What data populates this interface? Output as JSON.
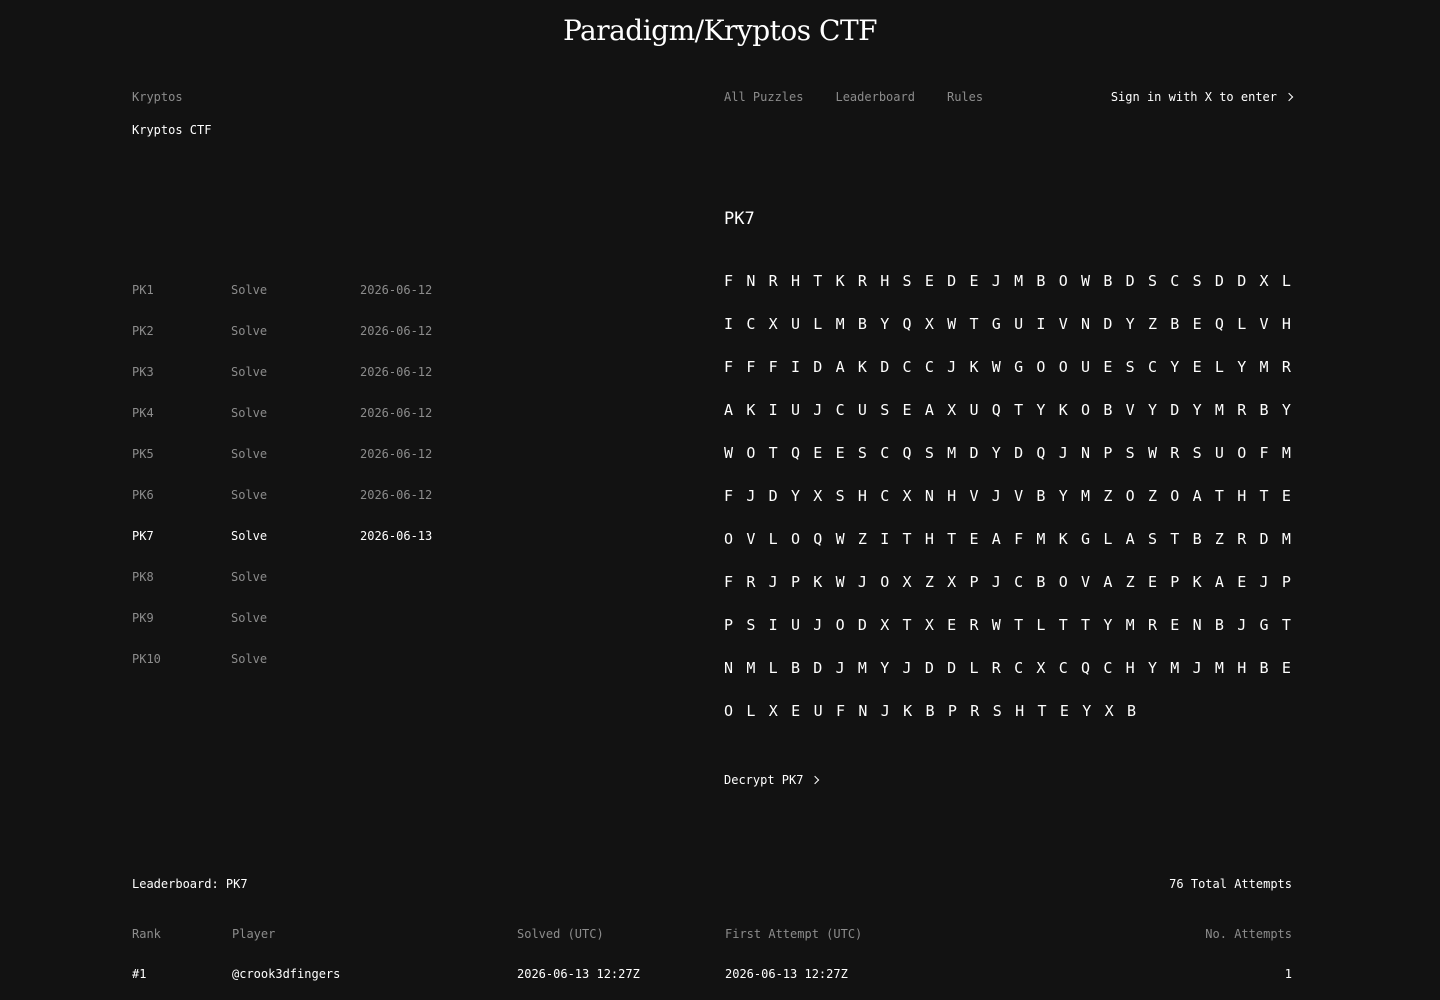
{
  "header": {
    "title": "Paradigm/Kryptos CTF"
  },
  "breadcrumb": {
    "parent": "Kryptos",
    "current": "Kryptos CTF"
  },
  "nav": {
    "items": [
      "All Puzzles",
      "Leaderboard",
      "Rules"
    ],
    "signin": "Sign in with X to enter"
  },
  "puzzles": [
    {
      "id": "PK1",
      "status": "Solve",
      "date": "2026-06-12"
    },
    {
      "id": "PK2",
      "status": "Solve",
      "date": "2026-06-12"
    },
    {
      "id": "PK3",
      "status": "Solve",
      "date": "2026-06-12"
    },
    {
      "id": "PK4",
      "status": "Solve",
      "date": "2026-06-12"
    },
    {
      "id": "PK5",
      "status": "Solve",
      "date": "2026-06-12"
    },
    {
      "id": "PK6",
      "status": "Solve",
      "date": "2026-06-12"
    },
    {
      "id": "PK7",
      "status": "Solve",
      "date": "2026-06-13",
      "active": true
    },
    {
      "id": "PK8",
      "status": "Solve",
      "date": ""
    },
    {
      "id": "PK9",
      "status": "Solve",
      "date": ""
    },
    {
      "id": "PK10",
      "status": "Solve",
      "date": ""
    }
  ],
  "puzzle": {
    "title": "PK7",
    "ciphertext_rows": [
      "FNRHTKRHSEDEJMBOWBDSCSDDXL",
      "ICXULMBYQXWTGUIVNDYZBEQLVH",
      "FFFIDAKDCCJKWGOOUESCYELYMR",
      "AKIUJCUSEAXUQTYKOBVYDYMRBY",
      "WOTQEESCQSMDYDQJNPSWRSUOFM",
      "FJDYXSHCXNHVJVBYMZOZOATHTE",
      "OVLOQWZITHTEAFMKGLASTBZRDM",
      "FRJPKWJOXZXPJCBOVAZEPKAEJP",
      "PSIUJODXTXERWTLTTYMRENBJGT",
      "NMLBDJMYJDDLRCXCQCHYMJMHBE",
      "OLXEUFNJKBPRSHTEYXB"
    ],
    "decrypt_label": "Decrypt PK7"
  },
  "leaderboard": {
    "title": "Leaderboard: PK7",
    "total": "76 Total Attempts",
    "columns": {
      "rank": "Rank",
      "player": "Player",
      "solved": "Solved (UTC)",
      "first": "First Attempt (UTC)",
      "attempts": "No. Attempts"
    },
    "rows": [
      {
        "rank": "#1",
        "player": "@crook3dfingers",
        "solved": "2026-06-13 12:27Z",
        "first": "2026-06-13 12:27Z",
        "attempts": "1"
      }
    ]
  }
}
